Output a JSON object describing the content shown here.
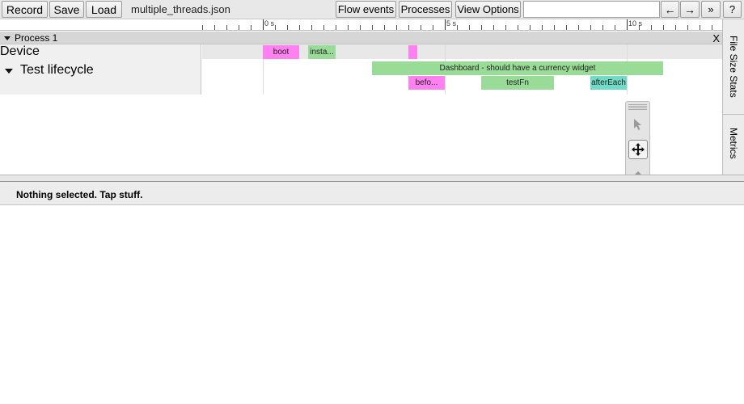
{
  "toolbar": {
    "record_label": "Record",
    "save_label": "Save",
    "load_label": "Load",
    "filename": "multiple_threads.json",
    "flow_events_label": "Flow events",
    "processes_label": "Processes",
    "view_options_label": "View Options",
    "search_value": "",
    "prev_label": "←",
    "next_label": "→",
    "expand_label": "»",
    "help_label": "?"
  },
  "ruler": {
    "tick_labels": [
      "0 s",
      "5 s",
      "10 s"
    ]
  },
  "process": {
    "title": "Process 1",
    "close_label": "X",
    "threads": [
      {
        "name": "Device",
        "slices": [
          {
            "label": "boot",
            "start": 0.0,
            "end": 1.0,
            "color": "#ff80f0",
            "depth": 0
          },
          {
            "label": "insta...",
            "start": 1.24,
            "end": 2.0,
            "color": "#98dc98",
            "depth": 0
          },
          {
            "label": "",
            "start": 4.0,
            "end": 4.24,
            "color": "#ff80f0",
            "depth": 0
          }
        ]
      },
      {
        "name": "Test lifecycle",
        "slices": [
          {
            "label": "Dashboard - should have a currency widget",
            "start": 3.0,
            "end": 11.0,
            "color": "#98dc98",
            "depth": 0
          },
          {
            "label": "befo...",
            "start": 4.0,
            "end": 5.0,
            "color": "#ff80f0",
            "depth": 1
          },
          {
            "label": "testFn",
            "start": 6.0,
            "end": 8.0,
            "color": "#98dc98",
            "depth": 1
          },
          {
            "label": "afterEach",
            "start": 9.0,
            "end": 10.0,
            "color": "#70dcc8",
            "depth": 1
          }
        ]
      }
    ]
  },
  "side_tabs": {
    "file_size_stats": "File Size Stats",
    "metrics": "Metrics"
  },
  "analysis": {
    "message": "Nothing selected. Tap stuff."
  },
  "colors": {
    "accent_pink": "#ff80f0",
    "accent_green": "#98dc98",
    "accent_teal": "#70dcc8"
  }
}
